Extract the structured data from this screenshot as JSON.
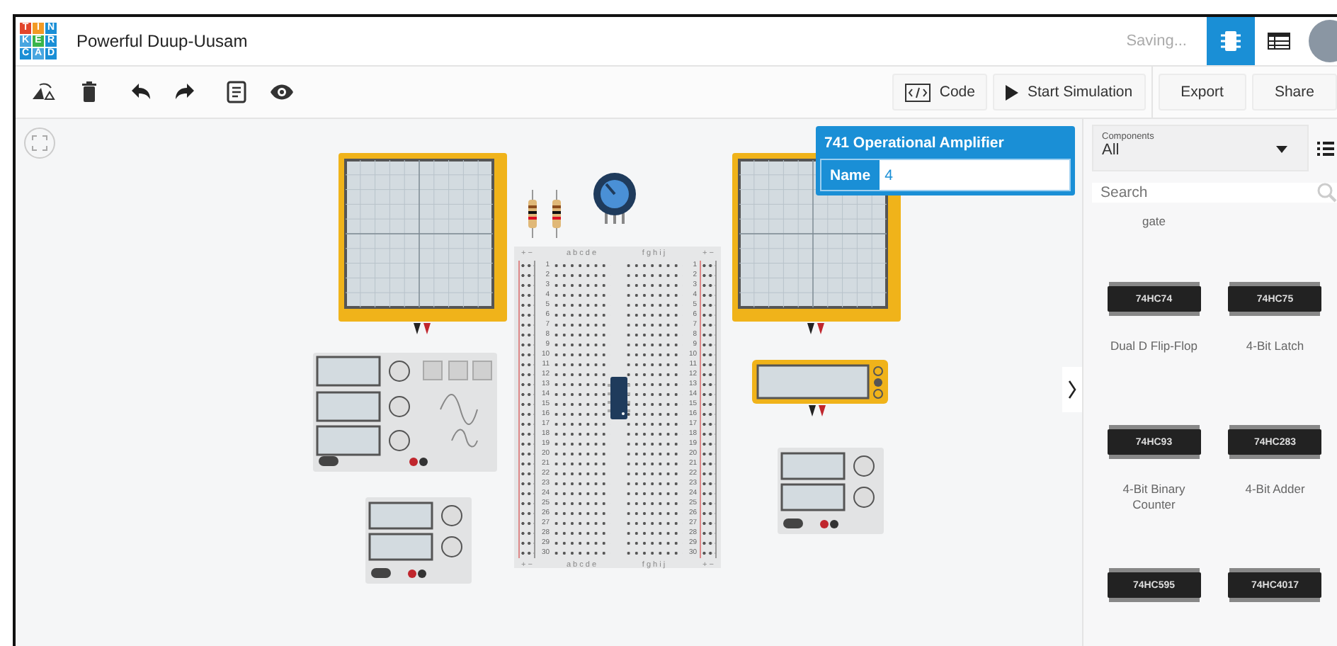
{
  "header": {
    "logo_letters": [
      "T",
      "I",
      "N",
      "K",
      "E",
      "R",
      "C",
      "A",
      "D"
    ],
    "title": "Powerful Duup-Uusam",
    "status": "Saving...",
    "views": [
      {
        "kind": "circuit",
        "selected": true
      },
      {
        "kind": "table",
        "selected": false
      }
    ]
  },
  "toolbar": {
    "tools": [
      {
        "kind": "rotate"
      },
      {
        "kind": "delete"
      },
      {
        "kind": "undo"
      },
      {
        "kind": "redo"
      },
      {
        "kind": "notes"
      },
      {
        "kind": "visibility"
      }
    ],
    "code_label": "Code",
    "simulate_label": "Start Simulation",
    "export_label": "Export",
    "share_label": "Share"
  },
  "canvas": {
    "breadboard": {
      "rail_labels": [
        {
          "plus": "+",
          "minus": "−"
        },
        {
          "plus": "+",
          "minus": "−"
        },
        {
          "plus": "+",
          "minus": "−"
        },
        {
          "plus": "+",
          "minus": "−"
        }
      ],
      "top_left_columns": "a b c d e",
      "top_right_columns": "f g h i j",
      "bottom_left_columns": "a b c d e",
      "bottom_right_columns": "f g h i j",
      "left_row_numbers": [
        "1",
        "2",
        "3",
        "4",
        "5",
        "6",
        "7",
        "8",
        "9",
        "10",
        "11",
        "12",
        "13",
        "14",
        "15",
        "16",
        "17",
        "18",
        "19",
        "20",
        "21",
        "22",
        "23",
        "24",
        "25",
        "26",
        "27",
        "28",
        "29",
        "30"
      ],
      "right_row_numbers": [
        "1",
        "2",
        "3",
        "4",
        "5",
        "6",
        "7",
        "8",
        "9",
        "10",
        "11",
        "12",
        "13",
        "14",
        "15",
        "16",
        "17",
        "18",
        "19",
        "20",
        "21",
        "22",
        "23",
        "24",
        "25",
        "26",
        "27",
        "28",
        "29",
        "30"
      ]
    },
    "inspector": {
      "title": "741 Operational Amplifier",
      "field_label": "Name",
      "field_value": "4"
    }
  },
  "panel": {
    "filter_label": "Components",
    "filter_value": "All",
    "search_placeholder": "Search",
    "cut_off_label": "gate",
    "parts": [
      {
        "chip": "74HC74",
        "name": "Dual D Flip-Flop"
      },
      {
        "chip": "74HC75",
        "name": "4-Bit Latch"
      },
      {
        "chip": "74HC93",
        "name": "4-Bit Binary Counter"
      },
      {
        "chip": "74HC283",
        "name": "4-Bit Adder"
      },
      {
        "chip": "74HC595"
      },
      {
        "chip": "74HC4017"
      }
    ]
  }
}
